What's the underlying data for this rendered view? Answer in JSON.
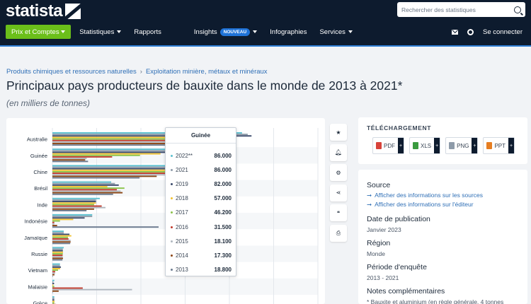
{
  "header": {
    "logo_text": "statista",
    "search_placeholder": "Rechercher des statistiques",
    "nav": {
      "prix": "Prix et Comptes",
      "statistiques": "Statistiques",
      "rapports": "Rapports",
      "insights": "Insights",
      "nouveau": "NOUVEAU",
      "infographies": "Infographies",
      "services": "Services",
      "login": "Se connecter"
    }
  },
  "breadcrumb": {
    "item1": "Produits chimiques et ressources naturelles",
    "sep": "›",
    "item2": "Exploitation minière, métaux et minéraux"
  },
  "title": "Principaux pays producteurs de bauxite dans le monde de 2013 à 2021*",
  "subtitle": "(en milliers de tonnes)",
  "chart_data": {
    "type": "bar",
    "orientation": "horizontal",
    "categories": [
      "Australie",
      "Guinée",
      "Chine",
      "Brésil",
      "Inde",
      "Indonésie",
      "Jamaïque",
      "Russie",
      "Vietnam",
      "Malaisie",
      "Grèce"
    ],
    "series": [
      {
        "name": "2022**",
        "color": "#5bc0d0",
        "values": [
          100000,
          86000,
          90000,
          31000,
          25000,
          21000,
          6000,
          6000,
          4000,
          1000,
          1000
        ]
      },
      {
        "name": "2021",
        "color": "#8e9ba9",
        "values": [
          103000,
          86000,
          86000,
          33000,
          23000,
          21000,
          6000,
          5500,
          4000,
          500,
          1000
        ]
      },
      {
        "name": "2019",
        "color": "#3b4a6b",
        "values": [
          105000,
          82000,
          75000,
          35000,
          23000,
          17000,
          9000,
          5500,
          4500,
          900,
          1000
        ]
      },
      {
        "name": "2018",
        "color": "#f1c232",
        "values": [
          96000,
          57000,
          79000,
          29000,
          23000,
          11000,
          10000,
          5600,
          4100,
          500,
          1100
        ]
      },
      {
        "name": "2017",
        "color": "#8bc34a",
        "values": [
          88000,
          46200,
          68000,
          38000,
          22000,
          4000,
          8200,
          5500,
          3000,
          1000,
          1000
        ]
      },
      {
        "name": "2016",
        "color": "#c0392b",
        "values": [
          82000,
          31500,
          65000,
          34000,
          26000,
          1000,
          8500,
          5400,
          1500,
          16000,
          1900
        ]
      },
      {
        "name": "2015",
        "color": "#b0b7bf",
        "values": [
          81000,
          18100,
          65000,
          36000,
          28000,
          1000,
          9600,
          5400,
          1400,
          42000,
          1900
        ]
      },
      {
        "name": "2014",
        "color": "#8b4513",
        "values": [
          79000,
          17300,
          55000,
          37000,
          22000,
          2500,
          9600,
          5600,
          1100,
          3300,
          1900
        ]
      },
      {
        "name": "2013",
        "color": "#6b7a8f",
        "values": [
          81000,
          18800,
          46000,
          32000,
          18000,
          56000,
          9400,
          5300,
          250,
          200,
          1900
        ]
      }
    ],
    "tooltip": {
      "title": "Guinée",
      "rows": [
        {
          "year": "2022**",
          "value": "86.000",
          "color": "#5bc0d0"
        },
        {
          "year": "2021",
          "value": "86.000",
          "color": "#8e9ba9"
        },
        {
          "year": "2019",
          "value": "82.000",
          "color": "#3b4a6b"
        },
        {
          "year": "2018",
          "value": "57.000",
          "color": "#f1c232"
        },
        {
          "year": "2017",
          "value": "46.200",
          "color": "#8bc34a"
        },
        {
          "year": "2016",
          "value": "31.500",
          "color": "#c0392b"
        },
        {
          "year": "2015",
          "value": "18.100",
          "color": "#b0b7bf"
        },
        {
          "year": "2014",
          "value": "17.300",
          "color": "#8b4513"
        },
        {
          "year": "2013",
          "value": "18.800",
          "color": "#6b7a8f"
        }
      ]
    },
    "xlim": [
      0,
      140000
    ],
    "grid": true
  },
  "toolbar_icons": [
    "star-icon",
    "bell-icon",
    "gear-icon",
    "share-icon",
    "quote-icon",
    "print-icon"
  ],
  "download": {
    "title": "TÉLÉCHARGEMENT",
    "buttons": [
      {
        "label": "PDF",
        "color": "#d8433a"
      },
      {
        "label": "XLS",
        "color": "#3a9b3f"
      },
      {
        "label": "PNG",
        "color": "#8e9ba9"
      },
      {
        "label": "PPT",
        "color": "#e67e22"
      }
    ],
    "plus": "+"
  },
  "info": {
    "source_h": "Source",
    "source_link1": "Afficher des informations sur les sources",
    "source_link2": "Afficher des informations sur l'éditeur",
    "arrow": "➞",
    "pub_h": "Date de publication",
    "pub_v": "Janvier 2023",
    "region_h": "Région",
    "region_v": "Monde",
    "period_h": "Période d'enquête",
    "period_v": "2013 - 2021",
    "notes_h": "Notes complémentaires",
    "notes_v": "* Bauxite et aluminium (en règle générale, 4 tonnes"
  }
}
